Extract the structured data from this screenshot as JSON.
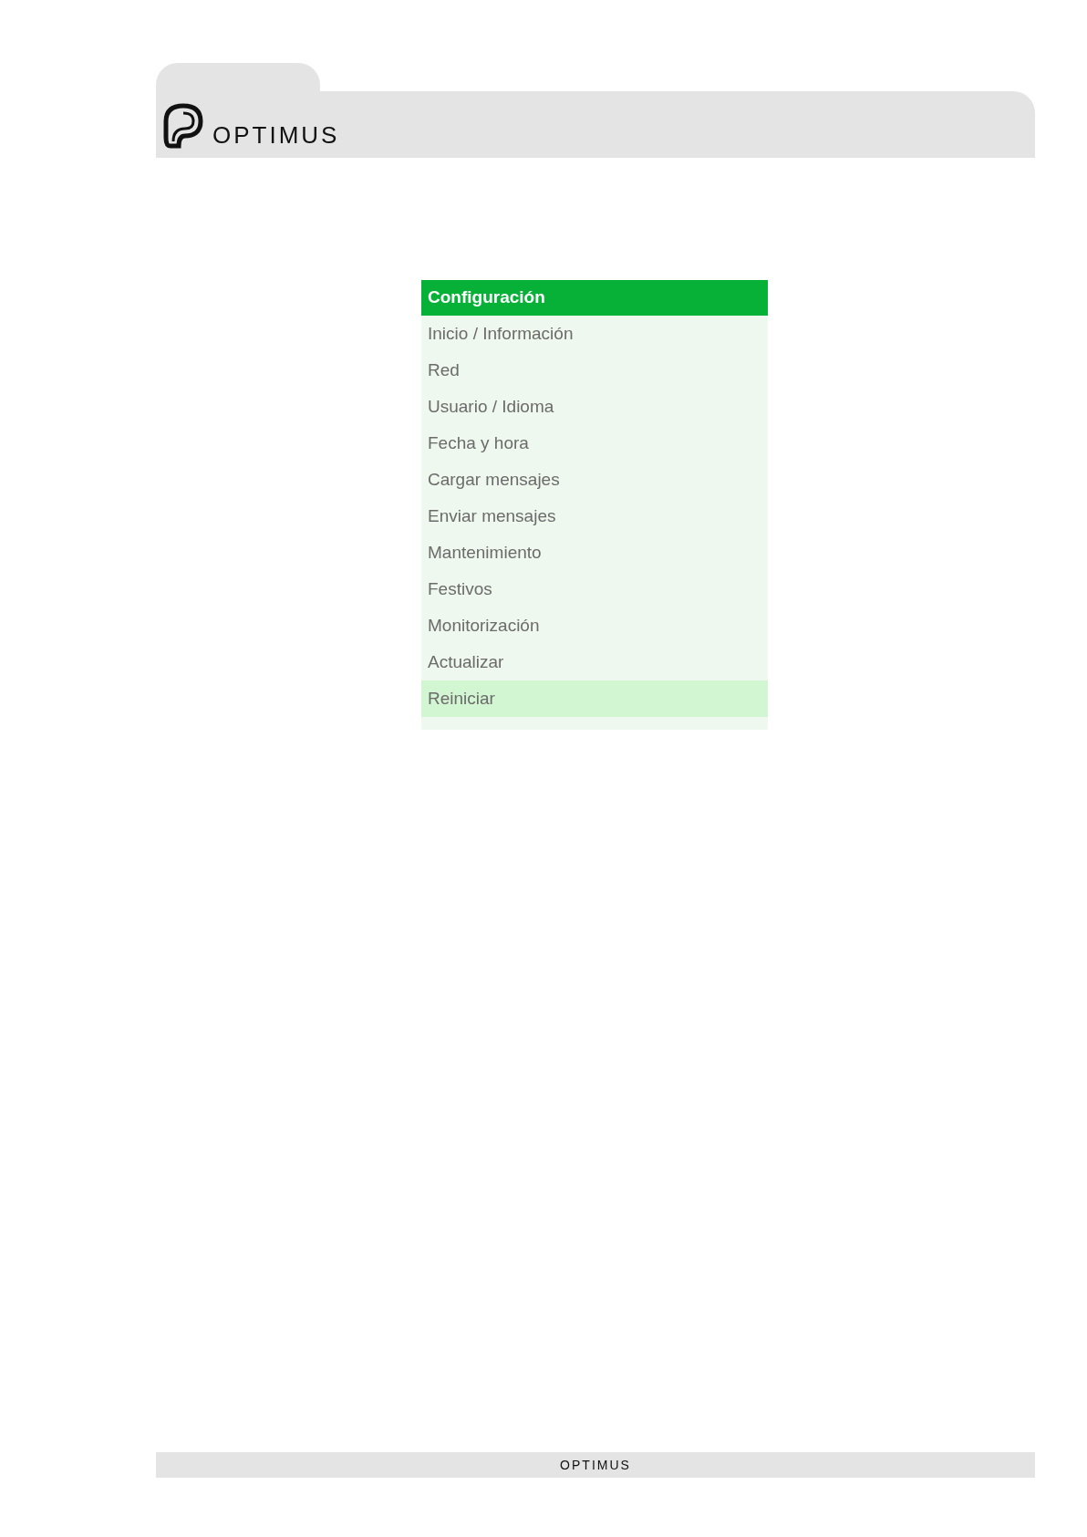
{
  "header": {
    "brand": "OPTIMUS"
  },
  "menu": {
    "title": "Configuración",
    "items": [
      {
        "label": "Inicio / Información",
        "selected": false
      },
      {
        "label": "Red",
        "selected": false
      },
      {
        "label": "Usuario / Idioma",
        "selected": false
      },
      {
        "label": "Fecha y hora",
        "selected": false
      },
      {
        "label": "Cargar mensajes",
        "selected": false
      },
      {
        "label": "Enviar mensajes",
        "selected": false
      },
      {
        "label": "Mantenimiento",
        "selected": false
      },
      {
        "label": "Festivos",
        "selected": false
      },
      {
        "label": "Monitorización",
        "selected": false
      },
      {
        "label": "Actualizar",
        "selected": false
      },
      {
        "label": "Reiniciar",
        "selected": true
      }
    ]
  },
  "footer": {
    "brand": "OPTIMUS"
  }
}
